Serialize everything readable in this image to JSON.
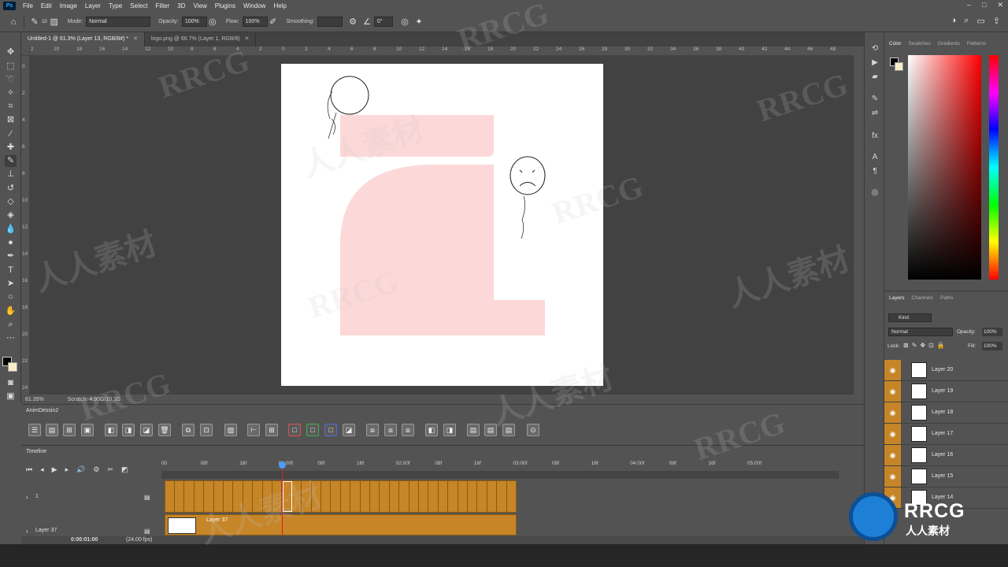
{
  "menubar": {
    "app_icon": "Ps",
    "items": [
      "File",
      "Edit",
      "Image",
      "Layer",
      "Type",
      "Select",
      "Filter",
      "3D",
      "View",
      "Plugins",
      "Window",
      "Help"
    ]
  },
  "options": {
    "brush_size": "10",
    "mode_label": "Mode:",
    "mode_value": "Normal",
    "opacity_label": "Opacity:",
    "opacity_value": "100%",
    "flow_label": "Flow:",
    "flow_value": "100%",
    "smoothing_label": "Smoothing:",
    "angle_value": "0°"
  },
  "tabs": [
    {
      "label": "Untitled-1 @ 61.3% (Layer 13, RGB/8#) *"
    },
    {
      "label": "logo.png @ 66.7% (Layer 1, RGB/8)"
    }
  ],
  "status": {
    "zoom": "61.35%",
    "scratch": "Scratch: 4.90G/10.1G"
  },
  "hruler_ticks": [
    "2",
    "20",
    "18",
    "16",
    "14",
    "12",
    "10",
    "8",
    "6",
    "4",
    "2",
    "0",
    "2",
    "4",
    "6",
    "8",
    "10",
    "12",
    "14",
    "16",
    "18",
    "20",
    "22",
    "24",
    "26",
    "28",
    "30",
    "32",
    "34",
    "36",
    "38",
    "40",
    "42",
    "44",
    "46",
    "48"
  ],
  "vruler_ticks": [
    "0",
    "2",
    "4",
    "6",
    "8",
    "10",
    "12",
    "14",
    "16",
    "18",
    "20",
    "22",
    "24"
  ],
  "color_panel": {
    "tabs": [
      "Color",
      "Swatches",
      "Gradients",
      "Patterns"
    ],
    "fg": "#000000",
    "bg": "#f6efc9"
  },
  "layers_panel": {
    "tabs": [
      "Layers",
      "Channels",
      "Paths"
    ],
    "filter": "Kind",
    "blend": "Normal",
    "opacity_label": "Opacity:",
    "opacity_value": "100%",
    "lock_label": "Lock:",
    "fill_label": "Fill:",
    "fill_value": "100%",
    "layers": [
      "Layer 20",
      "Layer 19",
      "Layer 18",
      "Layer 17",
      "Layer 16",
      "Layer 15",
      "Layer 14"
    ]
  },
  "anim_panel": {
    "title": "AnimDessin2"
  },
  "timeline": {
    "title": "Timeline",
    "ruler": [
      "00",
      "08f",
      "16f",
      "01:00f",
      "08f",
      "16f",
      "02:00f",
      "08f",
      "16f",
      "03:00f",
      "08f",
      "16f",
      "04:00f",
      "08f",
      "16f",
      "05:00f"
    ],
    "tracks": [
      {
        "name": "1"
      },
      {
        "name": "Layer 37"
      }
    ],
    "clip_label": "Layer 37",
    "current_time": "0:00:01:00",
    "fps": "(24.00 fps)"
  },
  "watermark": {
    "text_a": "RRCG",
    "text_b": "人人素材",
    "logo_text": "RRCG",
    "logo_sub": "人人素材"
  }
}
